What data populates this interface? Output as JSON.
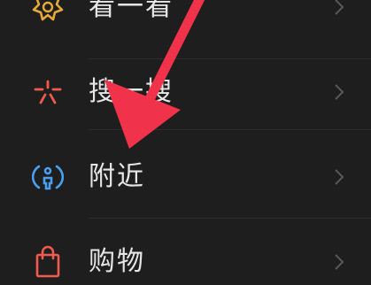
{
  "menu": {
    "items": [
      {
        "label": "看一看",
        "icon": "kan-yi-kan-icon"
      },
      {
        "label": "搜一搜",
        "icon": "sou-yi-sou-icon"
      },
      {
        "label": "附近",
        "icon": "nearby-icon"
      },
      {
        "label": "购物",
        "icon": "shopping-bag-icon"
      }
    ]
  },
  "colors": {
    "background": "#1e1e1e",
    "text": "#e6e6e6",
    "chevron": "#5a5a5a",
    "kan_icon": "#e6a93a",
    "sou_icon": "#f05a4f",
    "nearby_icon": "#4aa0f0",
    "shopping_icon": "#f05a4f",
    "annotation_arrow": "#f0334a"
  }
}
